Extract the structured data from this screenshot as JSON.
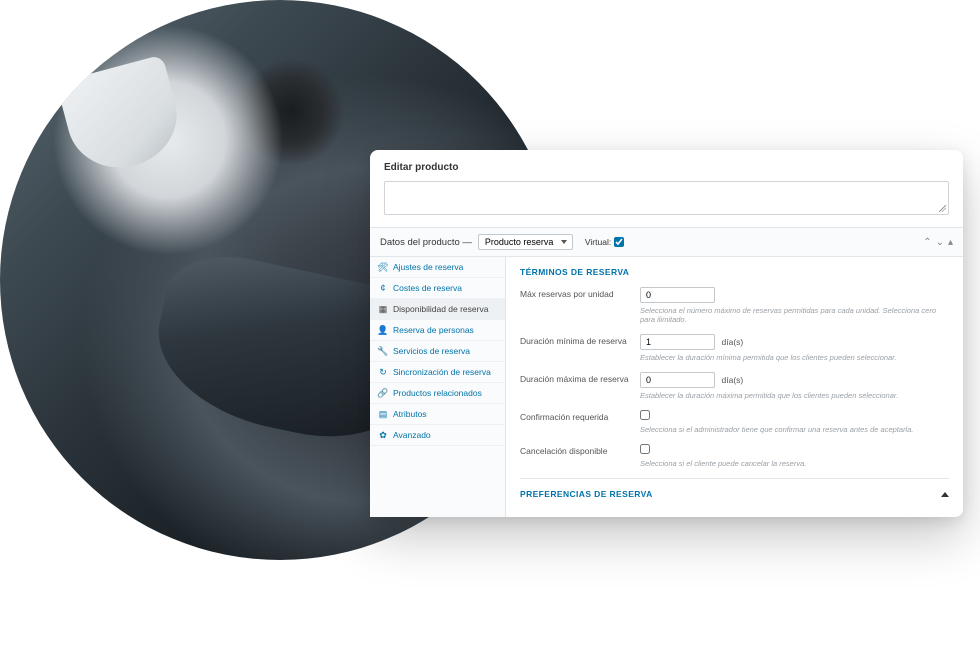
{
  "panel": {
    "title": "Editar producto"
  },
  "productDataBar": {
    "label": "Datos del producto —",
    "selectValue": "Producto reserva",
    "virtualLabel": "Virtual:",
    "virtualChecked": true,
    "controls": {
      "up": "⌃",
      "down": "⌄",
      "close": "▴"
    }
  },
  "sidebar": {
    "items": [
      {
        "icon": "⚙",
        "label": "Ajustes de reserva"
      },
      {
        "icon": "¢",
        "label": "Costes de reserva"
      },
      {
        "icon": "▦",
        "label": "Disponibilidad de reserva",
        "active": true
      },
      {
        "icon": "👤",
        "label": "Reserva de personas"
      },
      {
        "icon": "🔧",
        "label": "Servicios de reserva"
      },
      {
        "icon": "↻",
        "label": "Sincronización de reserva"
      },
      {
        "icon": "🔗",
        "label": "Productos relacionados"
      },
      {
        "icon": "▤",
        "label": "Atributos"
      },
      {
        "icon": "✿",
        "label": "Avanzado"
      }
    ]
  },
  "content": {
    "sectionTitle": "TÉRMINOS DE RESERVA",
    "fields": {
      "maxPerUnit": {
        "label": "Máx reservas por unidad",
        "value": "0",
        "help": "Selecciona el número máximo de reservas permitidas para cada unidad. Selecciona cero para ilimitado."
      },
      "minDuration": {
        "label": "Duración mínima de reserva",
        "value": "1",
        "unit": "día(s)",
        "help": "Establecer la duración mínima permitida que los clientes pueden seleccionar."
      },
      "maxDuration": {
        "label": "Duración máxima de reserva",
        "value": "0",
        "unit": "día(s)",
        "help": "Establecer la duración máxima permitida que los clientes pueden seleccionar."
      },
      "confirm": {
        "label": "Confirmación requerida",
        "help": "Selecciona si el administrador tiene que confirmar una reserva antes de aceptarla."
      },
      "cancel": {
        "label": "Cancelación disponible",
        "help": "Selecciona si el cliente puede cancelar la reserva."
      }
    },
    "prefsTitle": "PREFERENCIAS DE RESERVA"
  }
}
